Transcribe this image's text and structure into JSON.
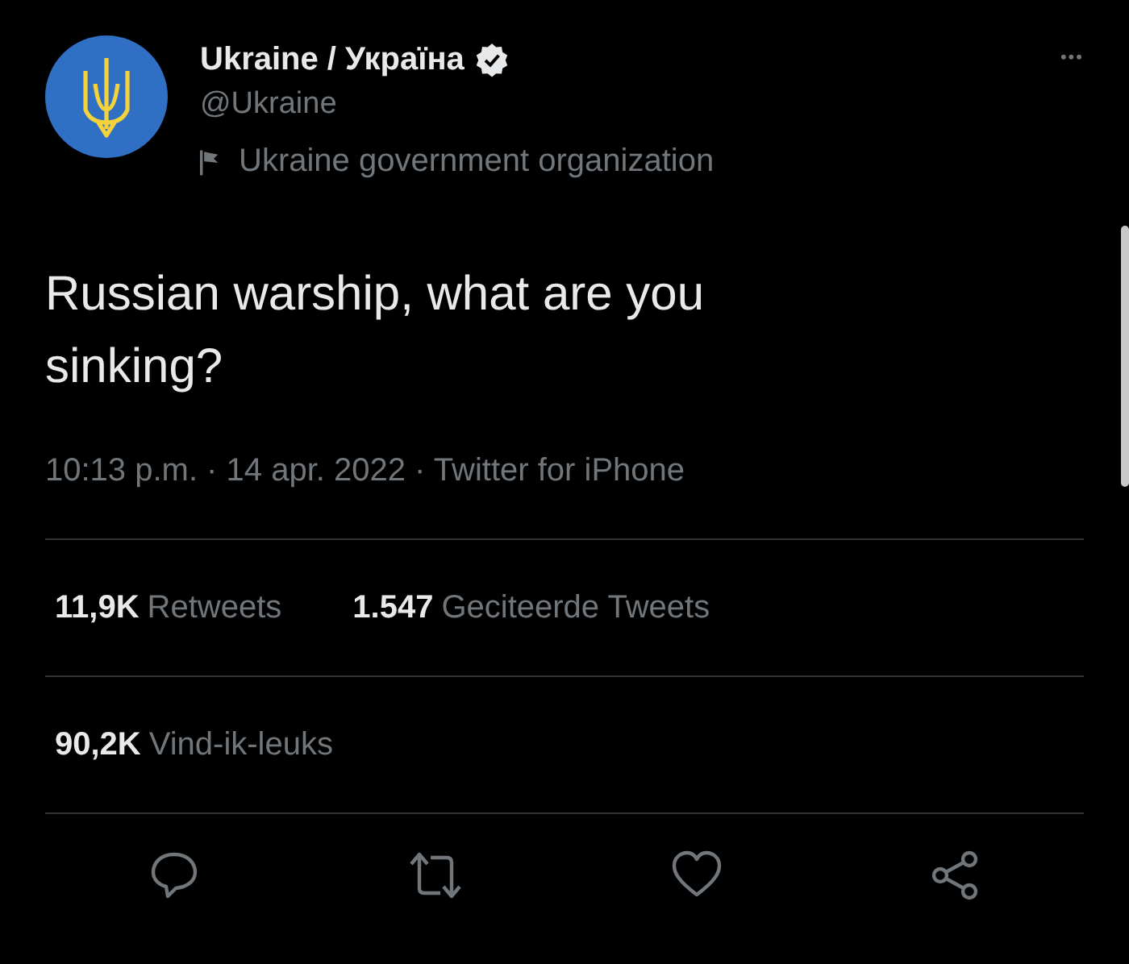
{
  "author": {
    "name": "Ukraine / Україна",
    "verified": true,
    "handle": "@Ukraine",
    "label": "Ukraine government organization"
  },
  "more": "•••",
  "text": "Russian warship, what are you sinking?",
  "meta": "10:13 p.m. · 14 apr. 2022 · Twitter for iPhone",
  "stat_rows": [
    [
      {
        "value": "11,9K",
        "label": "Retweets"
      },
      {
        "value": "1.547",
        "label": "Geciteerde Tweets"
      }
    ],
    [
      {
        "value": "90,2K",
        "label": "Vind-ik-leuks"
      }
    ]
  ],
  "actions": [
    {
      "kind": "reply"
    },
    {
      "kind": "retweet"
    },
    {
      "kind": "like"
    },
    {
      "kind": "share"
    }
  ]
}
